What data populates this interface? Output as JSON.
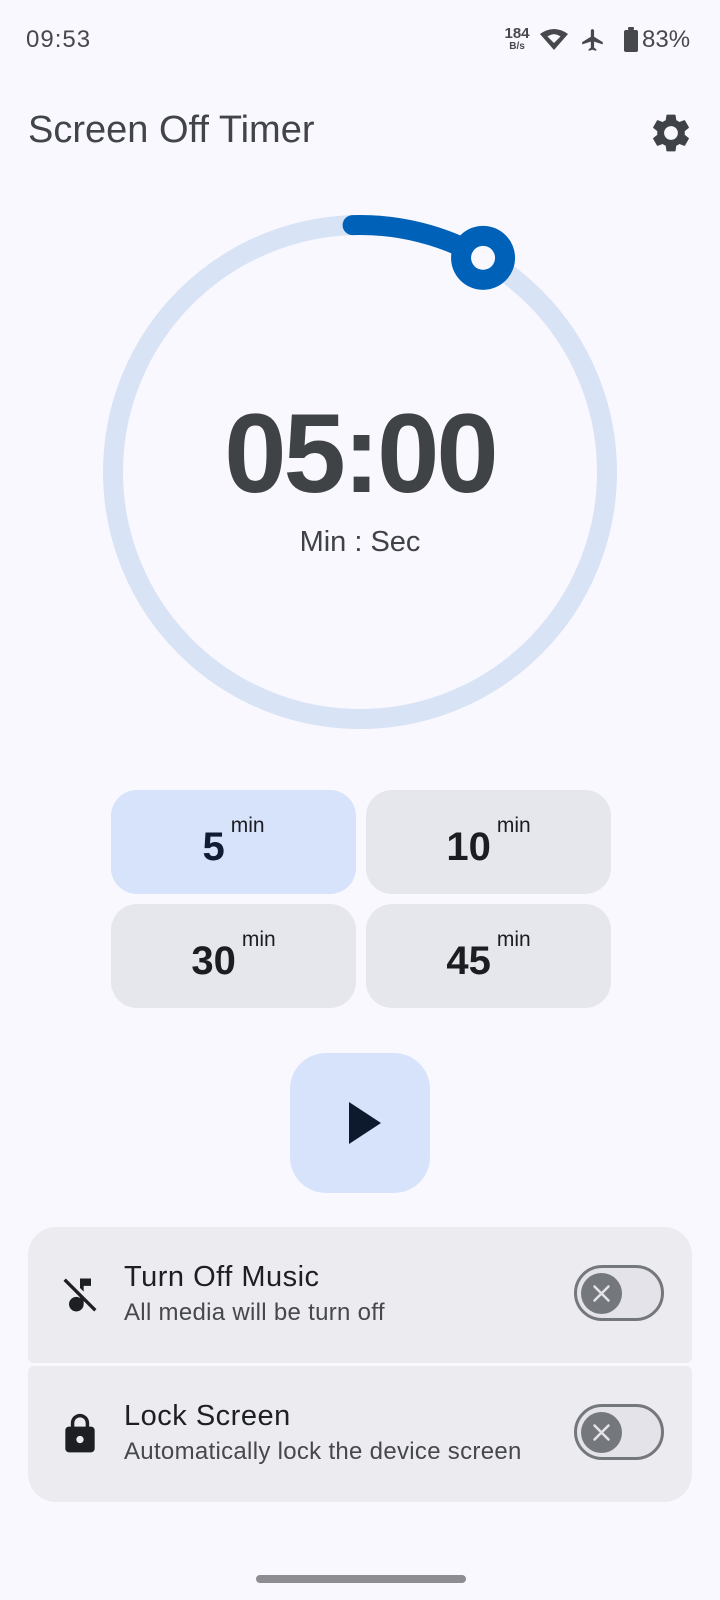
{
  "status_bar": {
    "time": "09:53",
    "net_speed_value": "184",
    "net_speed_unit": "B/s",
    "battery": "83%"
  },
  "header": {
    "title": "Screen Off Timer",
    "settings_icon": "gear-icon"
  },
  "timer": {
    "time": "05:00",
    "unit_label": "Min : Sec",
    "progress_fraction": 0.083,
    "track_color": "#d9e3f6",
    "progress_color": "#0061b8"
  },
  "presets": [
    {
      "value": "5",
      "unit": "min",
      "selected": true
    },
    {
      "value": "10",
      "unit": "min",
      "selected": false
    },
    {
      "value": "30",
      "unit": "min",
      "selected": false
    },
    {
      "value": "45",
      "unit": "min",
      "selected": false
    }
  ],
  "play_button": {
    "icon": "play-icon"
  },
  "options": [
    {
      "icon": "music-off-icon",
      "title": "Turn Off Music",
      "subtitle": "All media will be turn off",
      "enabled": false
    },
    {
      "icon": "lock-icon",
      "title": "Lock Screen",
      "subtitle": "Automatically lock the device screen",
      "enabled": false
    }
  ],
  "colors": {
    "background": "#f9f8fe",
    "selected_chip": "#d6e3fb",
    "chip": "#e6e7ec",
    "card": "#ebebf0"
  }
}
